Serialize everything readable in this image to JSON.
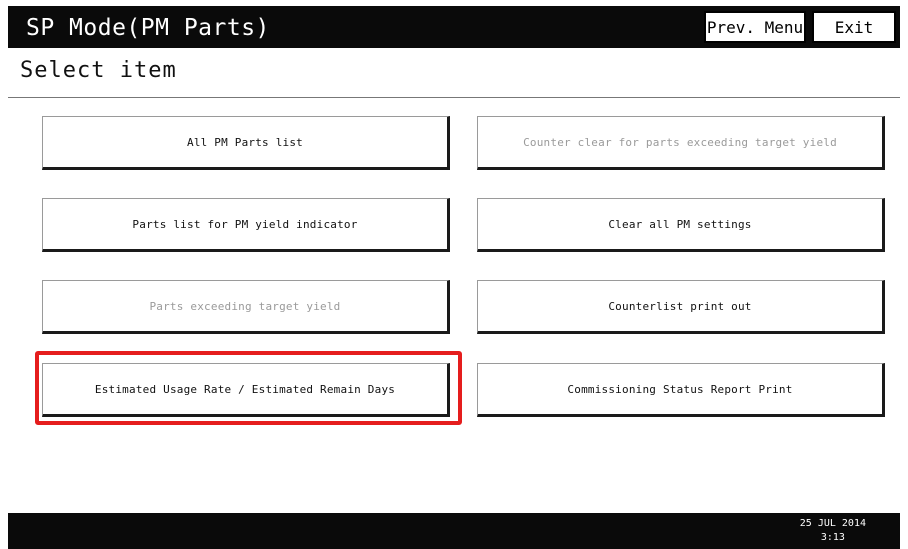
{
  "header": {
    "title": "SP Mode(PM Parts)",
    "prev_menu_label": "Prev. Menu",
    "exit_label": "Exit"
  },
  "subtitle": "Select item",
  "items": [
    {
      "label": "All PM Parts list",
      "enabled": true
    },
    {
      "label": "Counter clear for parts exceeding target yield",
      "enabled": false
    },
    {
      "label": "Parts list for PM yield indicator",
      "enabled": true
    },
    {
      "label": "Clear all PM settings",
      "enabled": true
    },
    {
      "label": "Parts exceeding target yield",
      "enabled": false
    },
    {
      "label": "Counterlist print out",
      "enabled": true
    },
    {
      "label": "Estimated Usage Rate / Estimated Remain Days",
      "enabled": true,
      "highlighted": true
    },
    {
      "label": "Commissioning Status Report Print",
      "enabled": true
    }
  ],
  "footer": {
    "date": "25 JUL  2014",
    "time": "3:13"
  },
  "colors": {
    "bar": "#0a0a0a",
    "highlight": "#e51d1d",
    "disabled_text": "#9a9a9a"
  }
}
